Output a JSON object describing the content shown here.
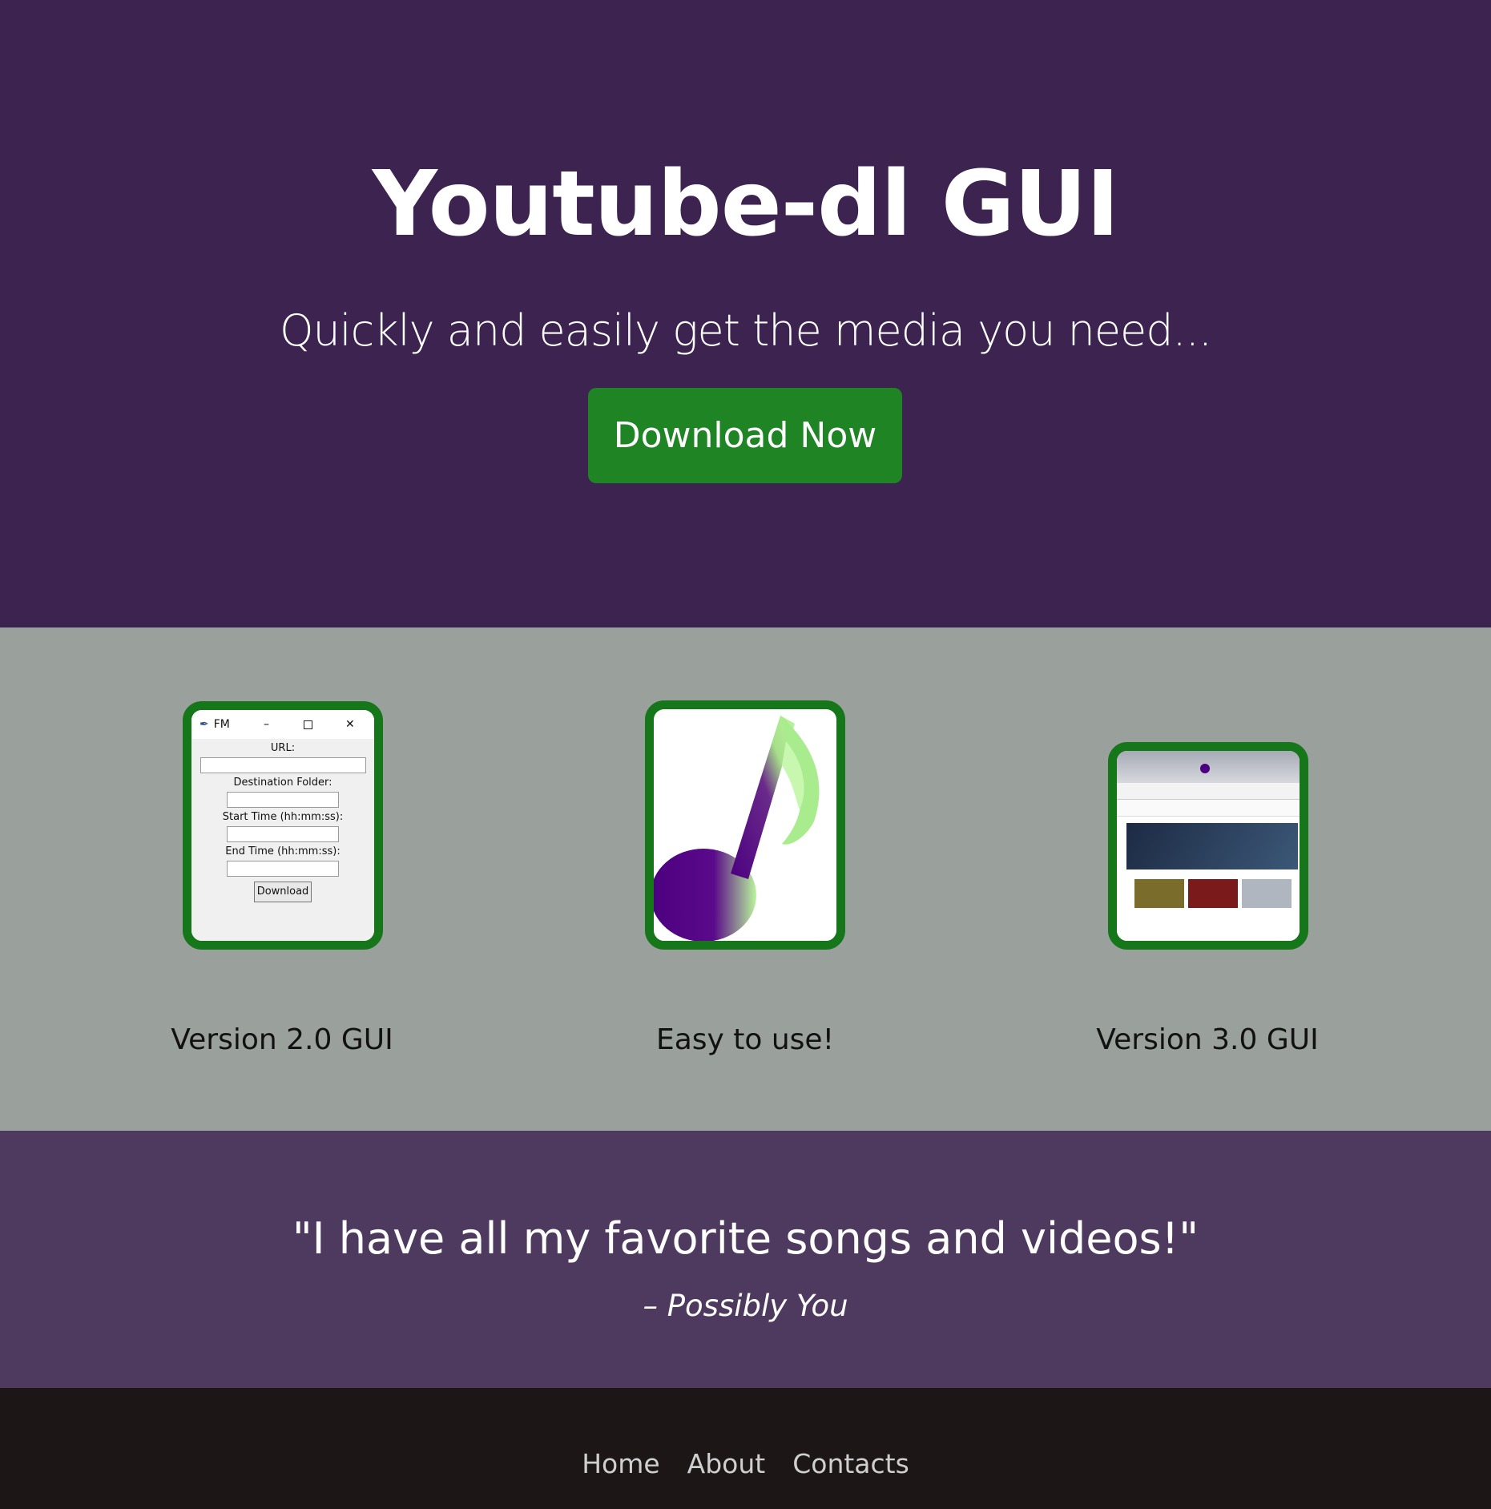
{
  "hero": {
    "title": "Youtube-dl GUI",
    "tagline": "Quickly and easily get the media you need...",
    "download_label": "Download Now"
  },
  "features": [
    {
      "caption": "Version 2.0 GUI",
      "window": {
        "title": "FM",
        "url_label": "URL:",
        "dest_label": "Destination Folder:",
        "start_label": "Start Time (hh:mm:ss):",
        "end_label": "End Time (hh:mm:ss):",
        "button_label": "Download"
      }
    },
    {
      "caption": "Easy to use!"
    },
    {
      "caption": "Version 3.0 GUI"
    }
  ],
  "testimonial": {
    "quote": "\"I have all my favorite songs and videos!\"",
    "author": "– Possibly You"
  },
  "footer": {
    "links": [
      "Home",
      "About",
      "Contacts"
    ]
  },
  "colors": {
    "hero_bg": "#3c2350",
    "features_bg": "#9aa09b",
    "button_green": "#1e8424",
    "frame_green": "#15761a",
    "quote_bg": "#4f3a5f",
    "footer_bg": "#1c1616"
  }
}
